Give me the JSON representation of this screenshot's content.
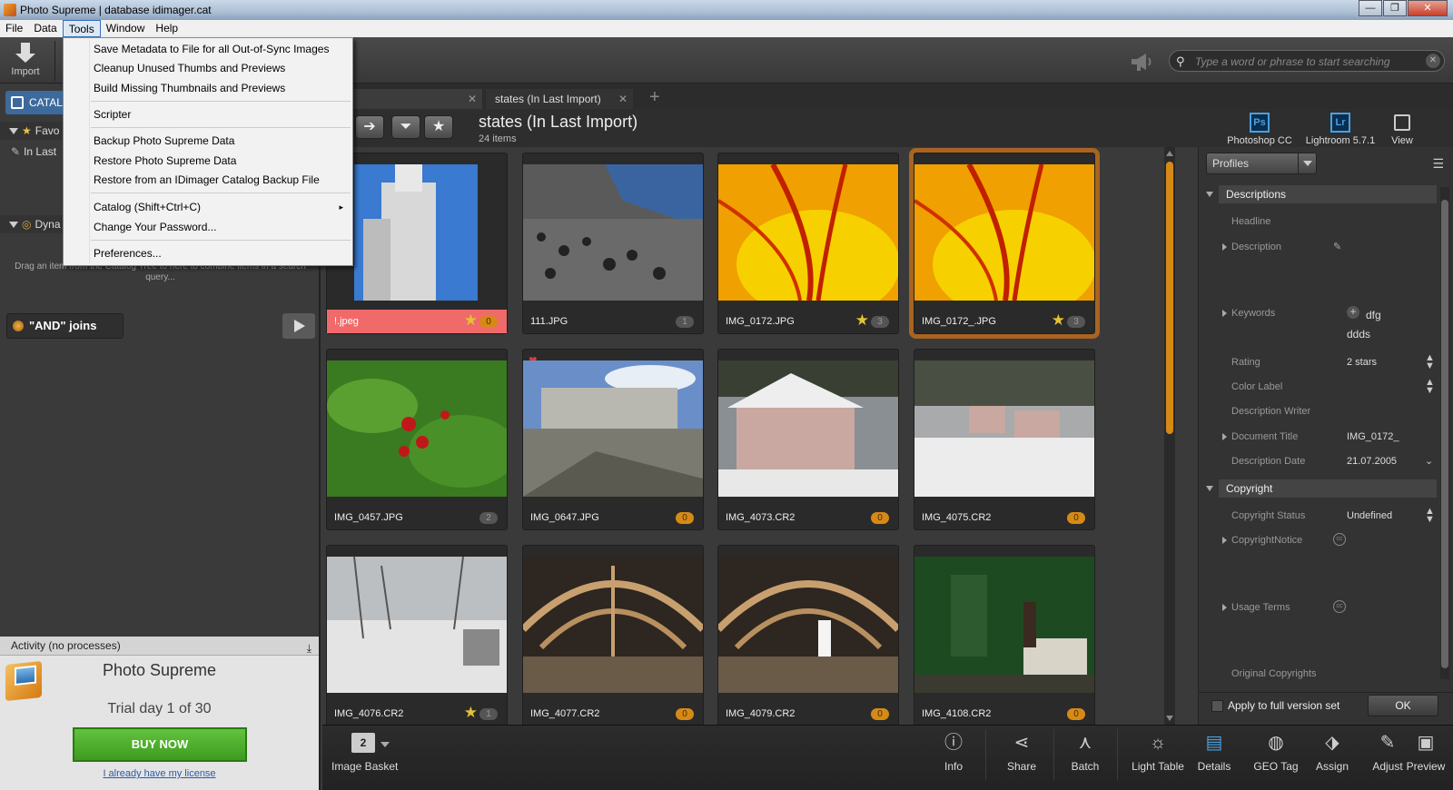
{
  "window": {
    "title": "Photo Supreme | database idimager.cat"
  },
  "menubar": [
    "File",
    "Data",
    "Tools",
    "Window",
    "Help"
  ],
  "tools_menu": {
    "groups": [
      [
        "Save Metadata to File for all Out-of-Sync Images",
        "Cleanup Unused Thumbs and Previews",
        "Build Missing Thumbnails and Previews"
      ],
      [
        "Scripter"
      ],
      [
        "Backup Photo Supreme Data",
        "Restore Photo Supreme Data",
        "Restore from an IDimager Catalog Backup File"
      ],
      [
        "Catalog (Shift+Ctrl+C)",
        "Change Your Password..."
      ],
      [
        "Preferences..."
      ]
    ],
    "submenu_arrow": "▸"
  },
  "toolbar": {
    "import_label": "Import",
    "search_placeholder": "Type a word or phrase to start searching"
  },
  "left": {
    "catalog_tab": "CATALO",
    "favorites_label": "Favo",
    "tree_item": "In Last",
    "dynamic_label": "Dyna",
    "drag_hint": "Drag an item from the Catalog Tree to here to combine items in a search query...",
    "and_joins": "\"AND\" joins"
  },
  "activity": {
    "header": "Activity (no processes)",
    "app_name": "Photo Supreme",
    "trial": "Trial day 1 of 30",
    "buy": "BUY NOW",
    "license": "I already have my license"
  },
  "tabs": [
    {
      "label": "",
      "active": false
    },
    {
      "label": "states (In Last Import)",
      "active": true
    }
  ],
  "view": {
    "title": "states (In Last Import)",
    "count": "24 items"
  },
  "apps": [
    {
      "label": "Photoshop CC",
      "logo": "Ps"
    },
    {
      "label": "Lightroom 5.7.1",
      "logo": "Lr"
    },
    {
      "label": "View",
      "logo": ""
    }
  ],
  "thumbnails": [
    {
      "name": "!.jpeg",
      "count": "0",
      "star": true,
      "red": true,
      "badge_color": "orange"
    },
    {
      "name": "111.JPG",
      "count": "1",
      "star": false,
      "badge_color": "gray"
    },
    {
      "name": "IMG_0172.JPG",
      "count": "3",
      "star": true,
      "badge_color": "gray"
    },
    {
      "name": "IMG_0172_.JPG",
      "count": "3",
      "star": true,
      "badge_color": "gray",
      "selected": true
    },
    {
      "name": "IMG_0457.JPG",
      "count": "2",
      "star": false,
      "badge_color": "gray"
    },
    {
      "name": "IMG_0647.JPG",
      "count": "0",
      "star": false,
      "badge_color": "orange",
      "heart": true
    },
    {
      "name": "IMG_4073.CR2",
      "count": "0",
      "star": false,
      "badge_color": "orange"
    },
    {
      "name": "IMG_4075.CR2",
      "count": "0",
      "star": false,
      "badge_color": "orange"
    },
    {
      "name": "IMG_4076.CR2",
      "count": "1",
      "star": true,
      "badge_color": "gray"
    },
    {
      "name": "IMG_4077.CR2",
      "count": "0",
      "star": false,
      "badge_color": "orange"
    },
    {
      "name": "IMG_4079.CR2",
      "count": "0",
      "star": false,
      "badge_color": "orange"
    },
    {
      "name": "IMG_4108.CR2",
      "count": "0",
      "star": false,
      "badge_color": "orange"
    }
  ],
  "right": {
    "profiles": "Profiles",
    "sections": {
      "descriptions": "Descriptions",
      "copyright": "Copyright"
    },
    "fields": {
      "headline": "Headline",
      "description": "Description",
      "keywords": "Keywords",
      "keyword_values": [
        "dfg",
        "ddds"
      ],
      "rating": "Rating",
      "rating_value": "2 stars",
      "color_label": "Color Label",
      "description_writer": "Description Writer",
      "document_title": "Document Title",
      "document_title_value": "IMG_0172_",
      "description_date": "Description Date",
      "description_date_value": "21.07.2005",
      "copyright_status": "Copyright Status",
      "copyright_status_value": "Undefined",
      "copyright_notice": "CopyrightNotice",
      "usage_terms": "Usage Terms",
      "original_copyrights": "Original Copyrights"
    },
    "apply_full": "Apply to full version set",
    "ok": "OK"
  },
  "bottom": {
    "basket_count": "2",
    "basket_label": "Image Basket",
    "buttons": [
      "Info",
      "Share",
      "Batch",
      "Light Table",
      "Details",
      "GEO Tag",
      "Assign",
      "Adjust",
      "Preview"
    ]
  },
  "colors": {
    "accent_orange": "#d68a16",
    "selection": "#a86420",
    "buy_green": "#4eab2c",
    "catalog_blue": "#3d6a9c"
  }
}
